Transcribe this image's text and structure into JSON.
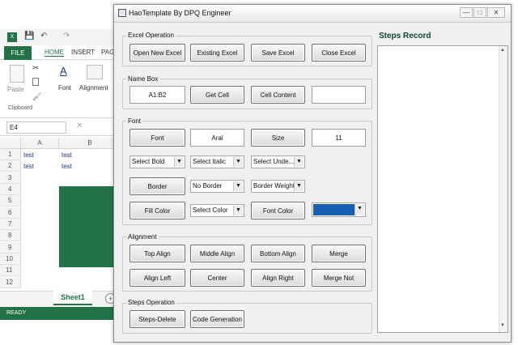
{
  "excel": {
    "file_tab": "FILE",
    "tabs": [
      "HOME",
      "INSERT",
      "PAG"
    ],
    "ribbon": {
      "paste": "Paste",
      "font": "Font",
      "alignment": "Alignment",
      "clipboard": "Clipboard"
    },
    "namebox": "E4",
    "columns": [
      "A",
      "B"
    ],
    "rows": [
      "1",
      "2",
      "3",
      "4",
      "5",
      "6",
      "7",
      "8",
      "9",
      "10",
      "11",
      "12"
    ],
    "cells": {
      "a1": "test",
      "b1": "test",
      "a2": "test",
      "b2": "test"
    },
    "sheet_tab": "Sheet1",
    "status": "READY",
    "fill_color": "#217346"
  },
  "dialog": {
    "title": "HaoTemplate By DPQ Engineer",
    "excel_operation": {
      "label": "Excel Operation",
      "buttons": [
        "Open New Excel",
        "Existing Excel",
        "Save Excel",
        "Close Excel"
      ]
    },
    "name_box": {
      "label": "Name Box",
      "range_value": "A1:B2",
      "get_cell": "Get Cell",
      "cell_content": "Cell Content",
      "content_value": ""
    },
    "font": {
      "label": "Font",
      "font_button": "Font",
      "font_value": "Aral",
      "size_button": "Size",
      "size_value": "11",
      "bold_select": "Select Bold",
      "italic_select": "Select Italic",
      "underline_select": "Select Unde...",
      "border_button": "Border",
      "border_select": "No Border",
      "border_weight_select": "Border Weight",
      "fill_color_button": "Fill Color",
      "color_select": "Select Color",
      "font_color_button": "Font Color",
      "font_color_swatch": "#1a5fb4"
    },
    "alignment": {
      "label": "Alignment",
      "buttons": [
        "Top Align",
        "Middle Align",
        "Bottom Align",
        "Merge",
        "Align Left",
        "Center",
        "Align Right",
        "Merge Not"
      ]
    },
    "steps_operation": {
      "label": "Steps Operation",
      "buttons": [
        "Steps-Delete",
        "Code Generation"
      ]
    },
    "steps_record": {
      "title": "Steps Record"
    }
  }
}
